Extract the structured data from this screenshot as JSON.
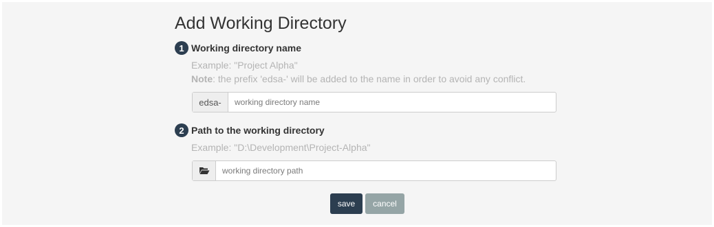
{
  "form": {
    "title": "Add Working Directory",
    "step1": {
      "number": "1",
      "title": "Working directory name",
      "example": "Example: \"Project Alpha\"",
      "note_label": "Note",
      "note_text": ": the prefix 'edsa-' will be added to the name in order to avoid any conflict.",
      "prefix": "edsa-",
      "placeholder": "working directory name",
      "value": ""
    },
    "step2": {
      "number": "2",
      "title": "Path to the working directory",
      "example": "Example: \"D:\\Development\\Project-Alpha\"",
      "icon": "folder-open-icon",
      "placeholder": "working directory path",
      "value": ""
    },
    "buttons": {
      "save": "save",
      "cancel": "cancel"
    }
  },
  "colors": {
    "background": "#f5f5f5",
    "primary": "#2c3e50",
    "secondary": "#95a5a6",
    "hint": "#b4b4b4"
  }
}
